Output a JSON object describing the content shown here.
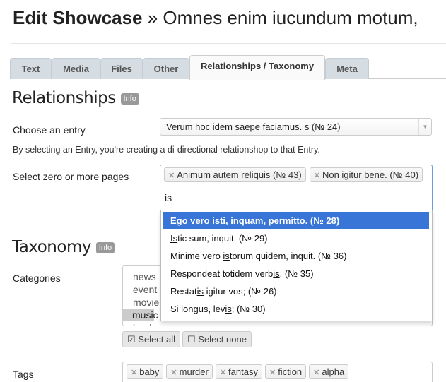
{
  "header": {
    "title_bold": "Edit Showcase",
    "title_rest": " » Omnes enim iucundum motum,"
  },
  "tabs": [
    {
      "label": "Text"
    },
    {
      "label": "Media"
    },
    {
      "label": "Files"
    },
    {
      "label": "Other"
    },
    {
      "label": "Relationships / Taxonomy",
      "active": true
    },
    {
      "label": "Meta"
    }
  ],
  "relationships": {
    "heading": "Relationships",
    "info": "Info",
    "entry_label": "Choose an entry",
    "entry_value": "Verum hoc idem saepe faciamus. s (№ 24)",
    "help": "By selecting an Entry, you're creating a di-directional relationshop to that Entry.",
    "pages_label": "Select zero or more pages",
    "selected_pages": [
      "Animum autem reliquis (№ 43)",
      "Non igitur bene. (№ 40)"
    ],
    "search_text": "is",
    "options": [
      {
        "pre": "Ego vero ",
        "match": "is",
        "post": "ti, inquam, permitto. (№ 28)",
        "highlighted": true
      },
      {
        "pre": "",
        "match": "Is",
        "post": "tic sum, inquit. (№ 29)"
      },
      {
        "pre": "Minime vero ",
        "match": "is",
        "post": "torum quidem, inquit. (№ 36)"
      },
      {
        "pre": "Respondeat totidem verb",
        "match": "is",
        "post": ". (№ 35)"
      },
      {
        "pre": "Restat",
        "match": "is",
        "post": " igitur vos; (№ 26)"
      },
      {
        "pre": "Si longus, lev",
        "match": "is",
        "post": "; (№ 30)"
      }
    ]
  },
  "taxonomy": {
    "heading": "Taxonomy",
    "info": "Info",
    "categories_label": "Categories",
    "categories": [
      "news",
      "event",
      "movie",
      "music",
      "book"
    ],
    "selected_category": "music",
    "select_all": "Select all",
    "select_none": "Select none",
    "tags_label": "Tags",
    "tags": [
      "baby",
      "murder",
      "fantasy",
      "fiction",
      "alpha"
    ]
  },
  "colors": {
    "highlight": "#3875d7",
    "tab_bg": "#d5dde3",
    "badge": "#999999"
  }
}
